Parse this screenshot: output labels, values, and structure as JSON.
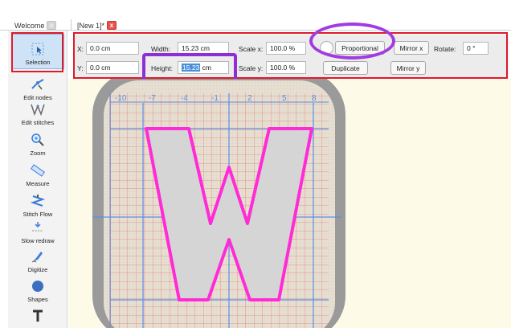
{
  "tabs": [
    {
      "label": "Welcome",
      "close": "x"
    },
    {
      "label": "[New 1]*",
      "close": "x"
    }
  ],
  "sidebar": {
    "tools": [
      {
        "label": "Selection",
        "icon": "selection-icon",
        "selected": true
      },
      {
        "label": "Edit nodes",
        "icon": "edit-nodes-icon"
      },
      {
        "label": "Edit stitches",
        "icon": "edit-stitches-icon"
      },
      {
        "label": "Zoom",
        "icon": "zoom-icon"
      },
      {
        "label": "Measure",
        "icon": "measure-icon"
      },
      {
        "label": "Stitch Flow",
        "icon": "stitch-flow-icon"
      },
      {
        "label": "Slow redraw",
        "icon": "slow-redraw-icon"
      },
      {
        "label": "Digitize",
        "icon": "digitize-icon"
      },
      {
        "label": "Shapes",
        "icon": "shapes-icon"
      },
      {
        "label": "",
        "icon": "text-icon"
      }
    ]
  },
  "props": {
    "x_label": "X:",
    "x_value": "0.0 cm",
    "y_label": "Y:",
    "y_value": "0.0 cm",
    "width_label": "Width:",
    "width_value": "15.23 cm",
    "height_label": "Height:",
    "height_selected": "15.23",
    "height_unit": "cm",
    "scalex_label": "Scale x:",
    "scalex_value": "100.0 %",
    "scaley_label": "Scale y:",
    "scaley_value": "100.0 %",
    "proportional_label": "Proportional",
    "duplicate_label": "Duplicate",
    "mirrorx_label": "Mirror x",
    "mirrory_label": "Mirror y",
    "rotate_label": "Rotate:",
    "rotate_value": "0 °"
  },
  "canvas": {
    "ruler_labels": [
      "-10",
      "-7",
      "-4",
      "-1",
      "2",
      "5",
      "8"
    ],
    "letter": "W",
    "colors": {
      "grid": "#e86a6a",
      "axis": "#5b8ee6",
      "outline": "#ff2bd6",
      "hoop": "#8c8c8c",
      "background": "#fdfbe8"
    }
  },
  "annotations": {
    "highlight_color": "#e0192b",
    "circle_color": "#a23be0"
  }
}
